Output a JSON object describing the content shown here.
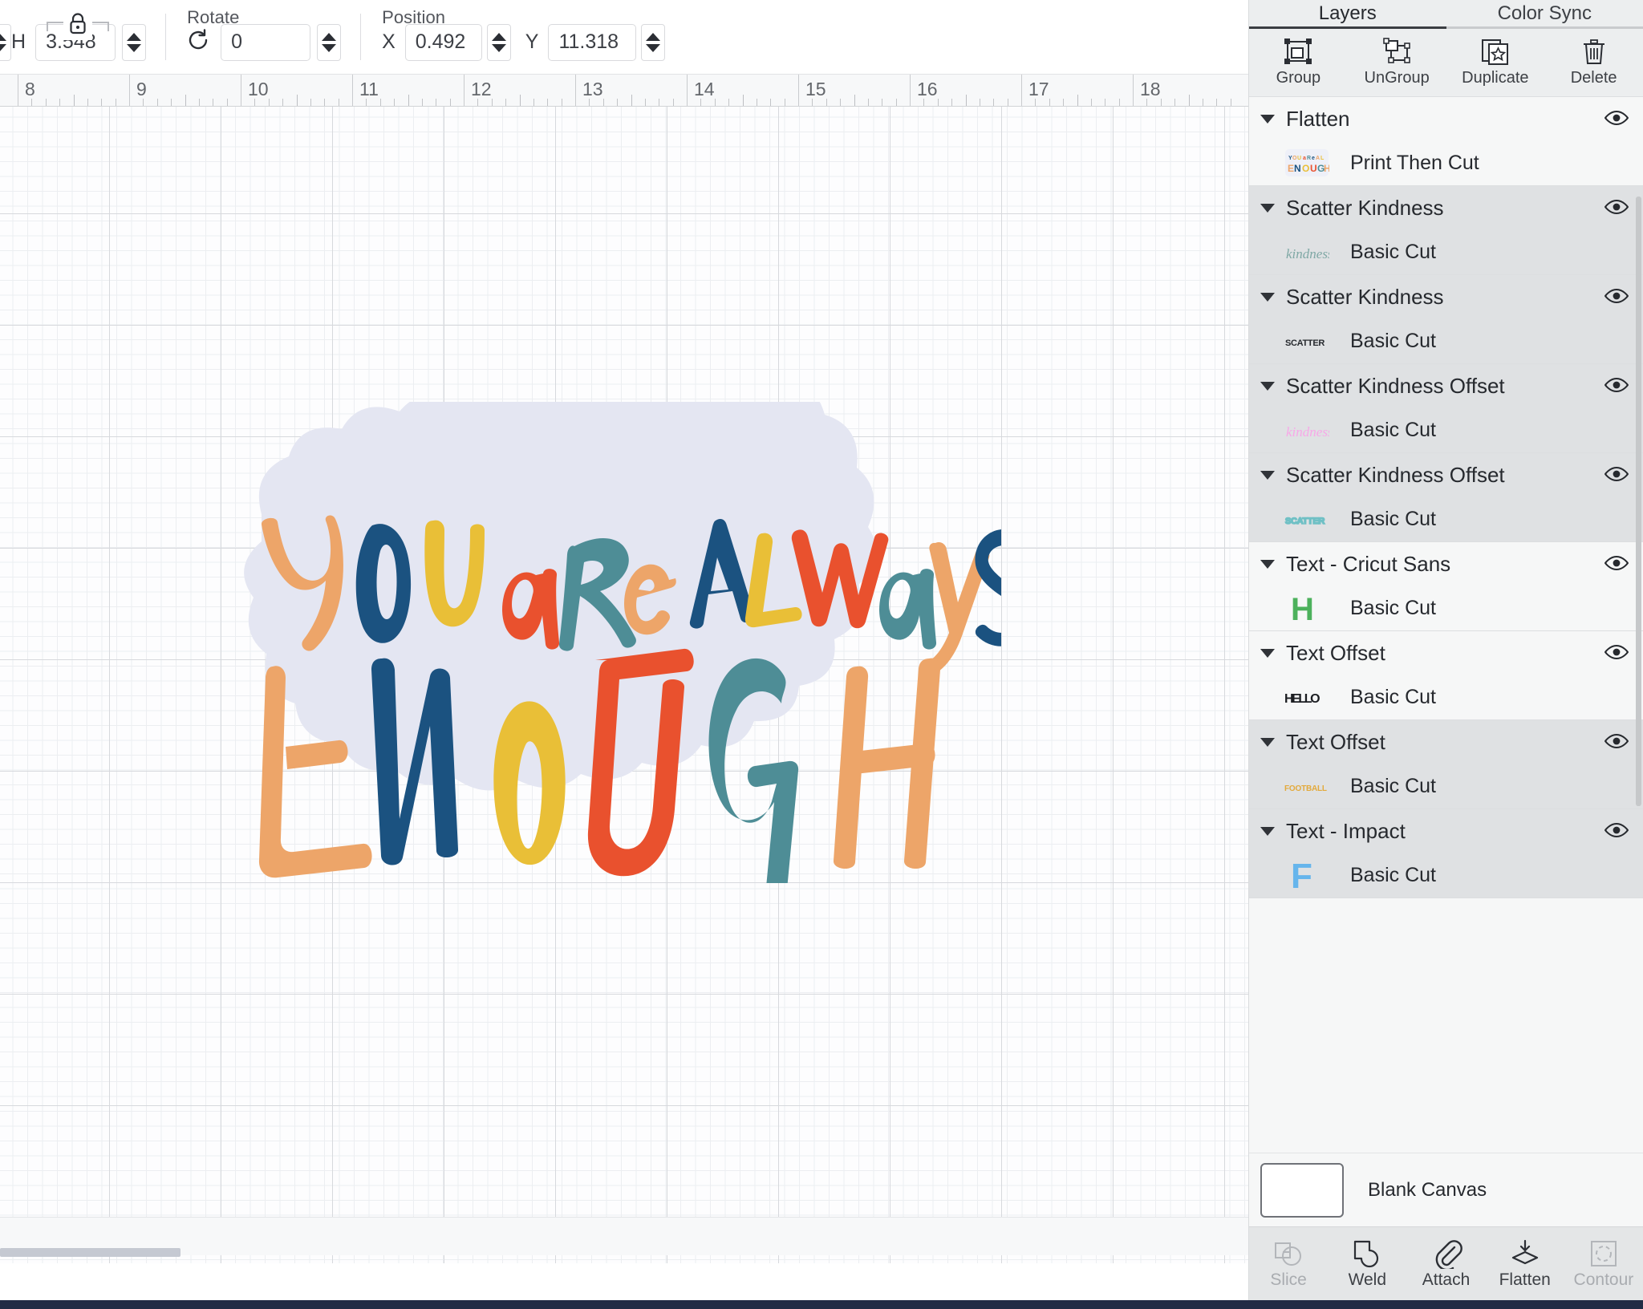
{
  "toolbar": {
    "size_group": {
      "lock_icon": "lock-icon",
      "height_letter": "H",
      "height_value": "3.548"
    },
    "rotate_group": {
      "label": "Rotate",
      "rotate_icon": "rotate-icon",
      "value": "0"
    },
    "position_group": {
      "label": "Position",
      "x_letter": "X",
      "x_value": "0.492",
      "y_letter": "Y",
      "y_value": "11.318"
    }
  },
  "ruler": {
    "unit": "inch",
    "ticks": [
      "8",
      "9",
      "10",
      "11",
      "12",
      "13",
      "14",
      "15",
      "16",
      "17",
      "18"
    ]
  },
  "canvas": {
    "artwork": {
      "line1": "YOU aRe ALWays",
      "line2": "ENOUGH",
      "sticker_background": "#e4e6f2",
      "palette": {
        "orange": "#eda569",
        "navy": "#1b5280",
        "yellow": "#e9bf37",
        "red": "#e9512e",
        "teal": "#4e8d96"
      }
    }
  },
  "panel": {
    "tabs": [
      {
        "label": "Layers",
        "active": true
      },
      {
        "label": "Color Sync",
        "active": false
      }
    ],
    "actions": [
      {
        "label": "Group",
        "icon": "group-icon"
      },
      {
        "label": "UnGroup",
        "icon": "ungroup-icon"
      },
      {
        "label": "Duplicate",
        "icon": "duplicate-icon"
      },
      {
        "label": "Delete",
        "icon": "trash-icon"
      }
    ],
    "layers": [
      {
        "title": "Flatten",
        "child_label": "Print Then Cut",
        "thumb": "sticker-thumb",
        "visible": true,
        "shade": "plain"
      },
      {
        "title": "Scatter Kindness",
        "child_label": "Basic Cut",
        "thumb": "kindness-script-teal-thumb",
        "visible": true,
        "shade": "alt"
      },
      {
        "title": "Scatter Kindness",
        "child_label": "Basic Cut",
        "thumb": "scatter-black-thumb",
        "visible": true,
        "shade": "alt"
      },
      {
        "title": "Scatter Kindness Offset",
        "child_label": "Basic Cut",
        "thumb": "kindness-script-pink-thumb",
        "visible": true,
        "shade": "alt"
      },
      {
        "title": "Scatter Kindness Offset",
        "child_label": "Basic Cut",
        "thumb": "scatter-teal-thumb",
        "visible": true,
        "shade": "alt"
      },
      {
        "title": "Text - Cricut Sans",
        "child_label": "Basic Cut",
        "thumb": "letter-h-green-thumb",
        "visible": true,
        "shade": "plain"
      },
      {
        "title": "Text Offset",
        "child_label": "Basic Cut",
        "thumb": "hello-black-thumb",
        "visible": true,
        "shade": "plain"
      },
      {
        "title": "Text Offset",
        "child_label": "Basic Cut",
        "thumb": "football-gold-thumb",
        "visible": true,
        "shade": "alt"
      },
      {
        "title": "Text - Impact",
        "child_label": "Basic Cut",
        "thumb": "letter-f-blue-thumb",
        "visible": true,
        "shade": "alt"
      }
    ],
    "canvas_row": {
      "label": "Blank Canvas",
      "swatch_color": "#ffffff"
    },
    "bottom_tools": [
      {
        "label": "Slice",
        "icon": "slice-icon",
        "enabled": false
      },
      {
        "label": "Weld",
        "icon": "weld-icon",
        "enabled": true
      },
      {
        "label": "Attach",
        "icon": "paperclip-icon",
        "enabled": true
      },
      {
        "label": "Flatten",
        "icon": "flatten-icon",
        "enabled": true
      },
      {
        "label": "Contour",
        "icon": "contour-icon",
        "enabled": false
      }
    ]
  }
}
